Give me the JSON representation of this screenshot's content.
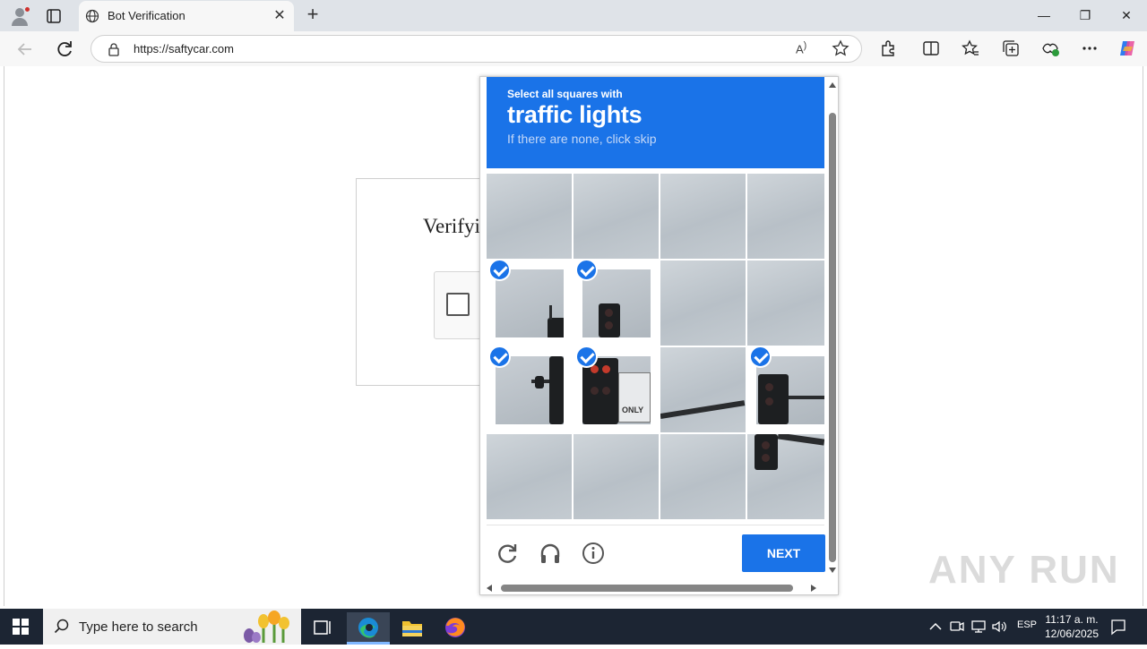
{
  "browser": {
    "tab_title": "Bot Verification",
    "url": "https://saftycar.com",
    "read_aloud_label": "A"
  },
  "page": {
    "verify_title": "Verifying you are human"
  },
  "captcha": {
    "instruction_small": "Select all squares with",
    "instruction_big": "traffic lights",
    "instruction_hint": "If there are none, click skip",
    "selected_cells": [
      [
        1,
        0
      ],
      [
        1,
        1
      ],
      [
        2,
        0
      ],
      [
        2,
        1
      ],
      [
        2,
        3
      ]
    ],
    "sign_text": "ONLY",
    "next_label": "NEXT",
    "accent_color": "#1a73e8"
  },
  "watermark": "ANY RUN",
  "taskbar": {
    "search_placeholder": "Type here to search",
    "language": "ESP",
    "time": "11:17 a. m.",
    "date": "12/06/2025"
  }
}
